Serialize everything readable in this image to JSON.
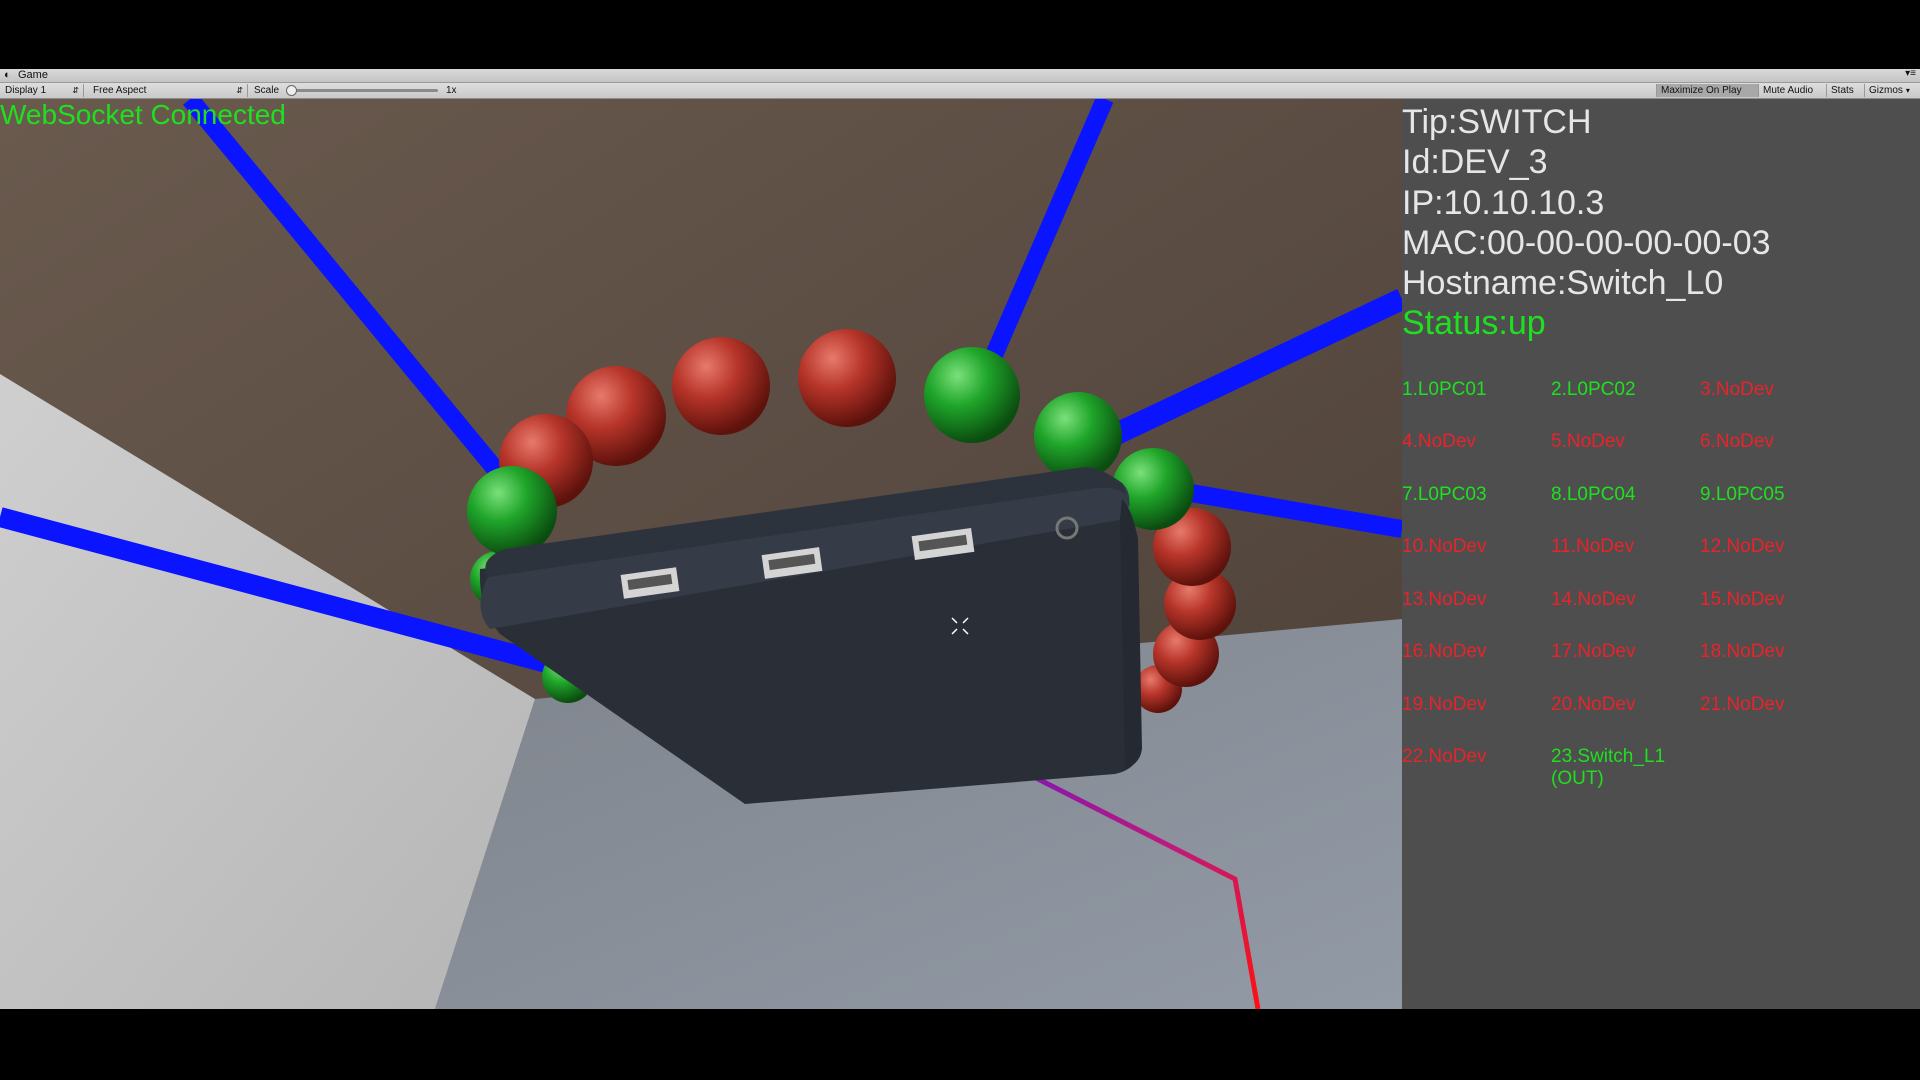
{
  "window": {
    "title": "Game"
  },
  "toolbar": {
    "display": "Display 1",
    "aspect": "Free Aspect",
    "scale_label": "Scale",
    "scale_value": "1x",
    "maximize": "Maximize On Play",
    "mute": "Mute Audio",
    "stats": "Stats",
    "gizmos": "Gizmos"
  },
  "hud": {
    "ws_status": "WebSocket Connected"
  },
  "device": {
    "tip": "Tip:SWITCH",
    "id": "Id:DEV_3",
    "ip": "IP:10.10.10.3",
    "mac": "MAC:00-00-00-00-00-03",
    "hostname": "Hostname:Switch_L0",
    "status": "Status:up"
  },
  "ports": [
    {
      "label": "1.L0PC01",
      "state": "up"
    },
    {
      "label": "2.L0PC02",
      "state": "up"
    },
    {
      "label": "3.NoDev",
      "state": "nodev"
    },
    {
      "label": "4.NoDev",
      "state": "nodev"
    },
    {
      "label": "5.NoDev",
      "state": "nodev"
    },
    {
      "label": "6.NoDev",
      "state": "nodev"
    },
    {
      "label": "7.L0PC03",
      "state": "up"
    },
    {
      "label": "8.L0PC04",
      "state": "up"
    },
    {
      "label": "9.L0PC05",
      "state": "up"
    },
    {
      "label": "10.NoDev",
      "state": "nodev"
    },
    {
      "label": "11.NoDev",
      "state": "nodev"
    },
    {
      "label": "12.NoDev",
      "state": "nodev"
    },
    {
      "label": "13.NoDev",
      "state": "nodev"
    },
    {
      "label": "14.NoDev",
      "state": "nodev"
    },
    {
      "label": "15.NoDev",
      "state": "nodev"
    },
    {
      "label": "16.NoDev",
      "state": "nodev"
    },
    {
      "label": "17.NoDev",
      "state": "nodev"
    },
    {
      "label": "18.NoDev",
      "state": "nodev"
    },
    {
      "label": "19.NoDev",
      "state": "nodev"
    },
    {
      "label": "20.NoDev",
      "state": "nodev"
    },
    {
      "label": "21.NoDev",
      "state": "nodev"
    },
    {
      "label": "22.NoDev",
      "state": "nodev"
    },
    {
      "label": "23.Switch_L1 (OUT)",
      "state": "up"
    }
  ],
  "colors": {
    "status_up": "#1fe01f",
    "status_nodev": "#e8232a",
    "link": "#0a14ff",
    "panel": "#4e4e4e"
  }
}
